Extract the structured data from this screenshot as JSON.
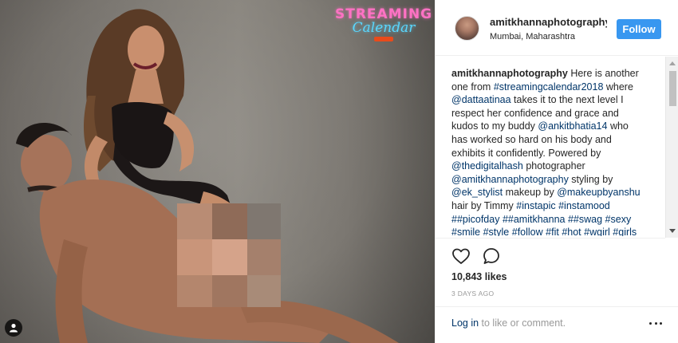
{
  "photo": {
    "brand_title": "STREAMING",
    "brand_subtitle": "Calendar"
  },
  "header": {
    "username": "amitkhannaphotography",
    "location": "Mumbai, Maharashtra",
    "follow_label": "Follow"
  },
  "caption": {
    "username": "amitkhannaphotography",
    "parts": [
      {
        "t": " Here is another one from ",
        "link": false
      },
      {
        "t": "#streamingcalendar2018",
        "link": true
      },
      {
        "t": " where ",
        "link": false
      },
      {
        "t": "@dattaatinaa",
        "link": true
      },
      {
        "t": " takes it to the next level I respect her confidence and grace and kudos to my buddy ",
        "link": false
      },
      {
        "t": "@ankitbhatia14",
        "link": true
      },
      {
        "t": " who has worked so hard on his body and exhibits it confidently. Powered by ",
        "link": false
      },
      {
        "t": "@thedigitalhash",
        "link": true
      },
      {
        "t": " photographer ",
        "link": false
      },
      {
        "t": "@amitkhannaphotography",
        "link": true
      },
      {
        "t": " styling by ",
        "link": false
      },
      {
        "t": "@ek_stylist",
        "link": true
      },
      {
        "t": " makeup by ",
        "link": false
      },
      {
        "t": "@makeupbyanshu",
        "link": true
      },
      {
        "t": " hair by Timmy ",
        "link": false
      },
      {
        "t": "#instapic",
        "link": true
      },
      {
        "t": " ",
        "link": false
      },
      {
        "t": "#instamood",
        "link": true
      },
      {
        "t": " ",
        "link": false
      },
      {
        "t": "##picofday",
        "link": true
      },
      {
        "t": " ",
        "link": false
      },
      {
        "t": "##amitkhanna",
        "link": true
      },
      {
        "t": " ",
        "link": false
      },
      {
        "t": "##swag",
        "link": true
      },
      {
        "t": " ",
        "link": false
      },
      {
        "t": "#sexy",
        "link": true
      },
      {
        "t": " ",
        "link": false
      },
      {
        "t": "#smile",
        "link": true
      },
      {
        "t": " ",
        "link": false
      },
      {
        "t": "#style",
        "link": true
      },
      {
        "t": " ",
        "link": false
      },
      {
        "t": "#follow",
        "link": true
      },
      {
        "t": " ",
        "link": false
      },
      {
        "t": "#fit",
        "link": true
      },
      {
        "t": " ",
        "link": false
      },
      {
        "t": "#hot",
        "link": true
      },
      {
        "t": " ",
        "link": false
      },
      {
        "t": "#wgirl",
        "link": true
      },
      {
        "t": " ",
        "link": false
      },
      {
        "t": "#girls",
        "link": true
      }
    ]
  },
  "stats": {
    "likes": "10,843 likes",
    "date": "3 DAYS AGO"
  },
  "comment": {
    "login_label": "Log in",
    "suffix": " to like or comment."
  },
  "icons": {
    "like": "heart-icon",
    "comment": "comment-bubble-icon",
    "more": "ellipsis-icon",
    "tag": "user-tag-icon"
  }
}
